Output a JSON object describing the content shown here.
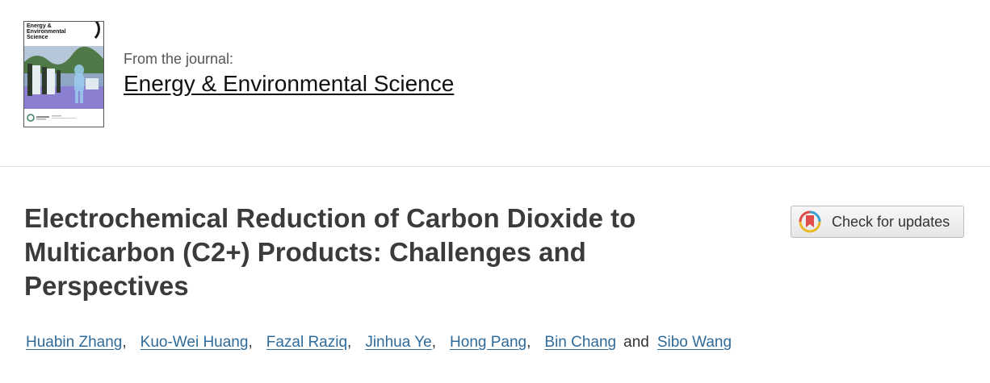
{
  "journal": {
    "from_label": "From the journal:",
    "name": "Energy & Environmental Science",
    "cover_title": "Energy & Environmental Science"
  },
  "article": {
    "title": "Electrochemical Reduction of Carbon Dioxide to Multicarbon (C2+) Products: Challenges and Perspectives"
  },
  "check_updates": {
    "label": "Check for updates",
    "icon": "crossmark-icon"
  },
  "authors": {
    "list": [
      "Huabin Zhang",
      "Kuo-Wei Huang",
      "Fazal Raziq",
      "Jinhua Ye",
      "Hong Pang",
      "Bin Chang",
      "Sibo Wang"
    ],
    "separator": ",",
    "conjunction": "and"
  },
  "colors": {
    "link": "#2f6b9a",
    "title": "#3b3b3b",
    "divider": "#e3e3e3",
    "button_bg": "#eeeeee"
  }
}
